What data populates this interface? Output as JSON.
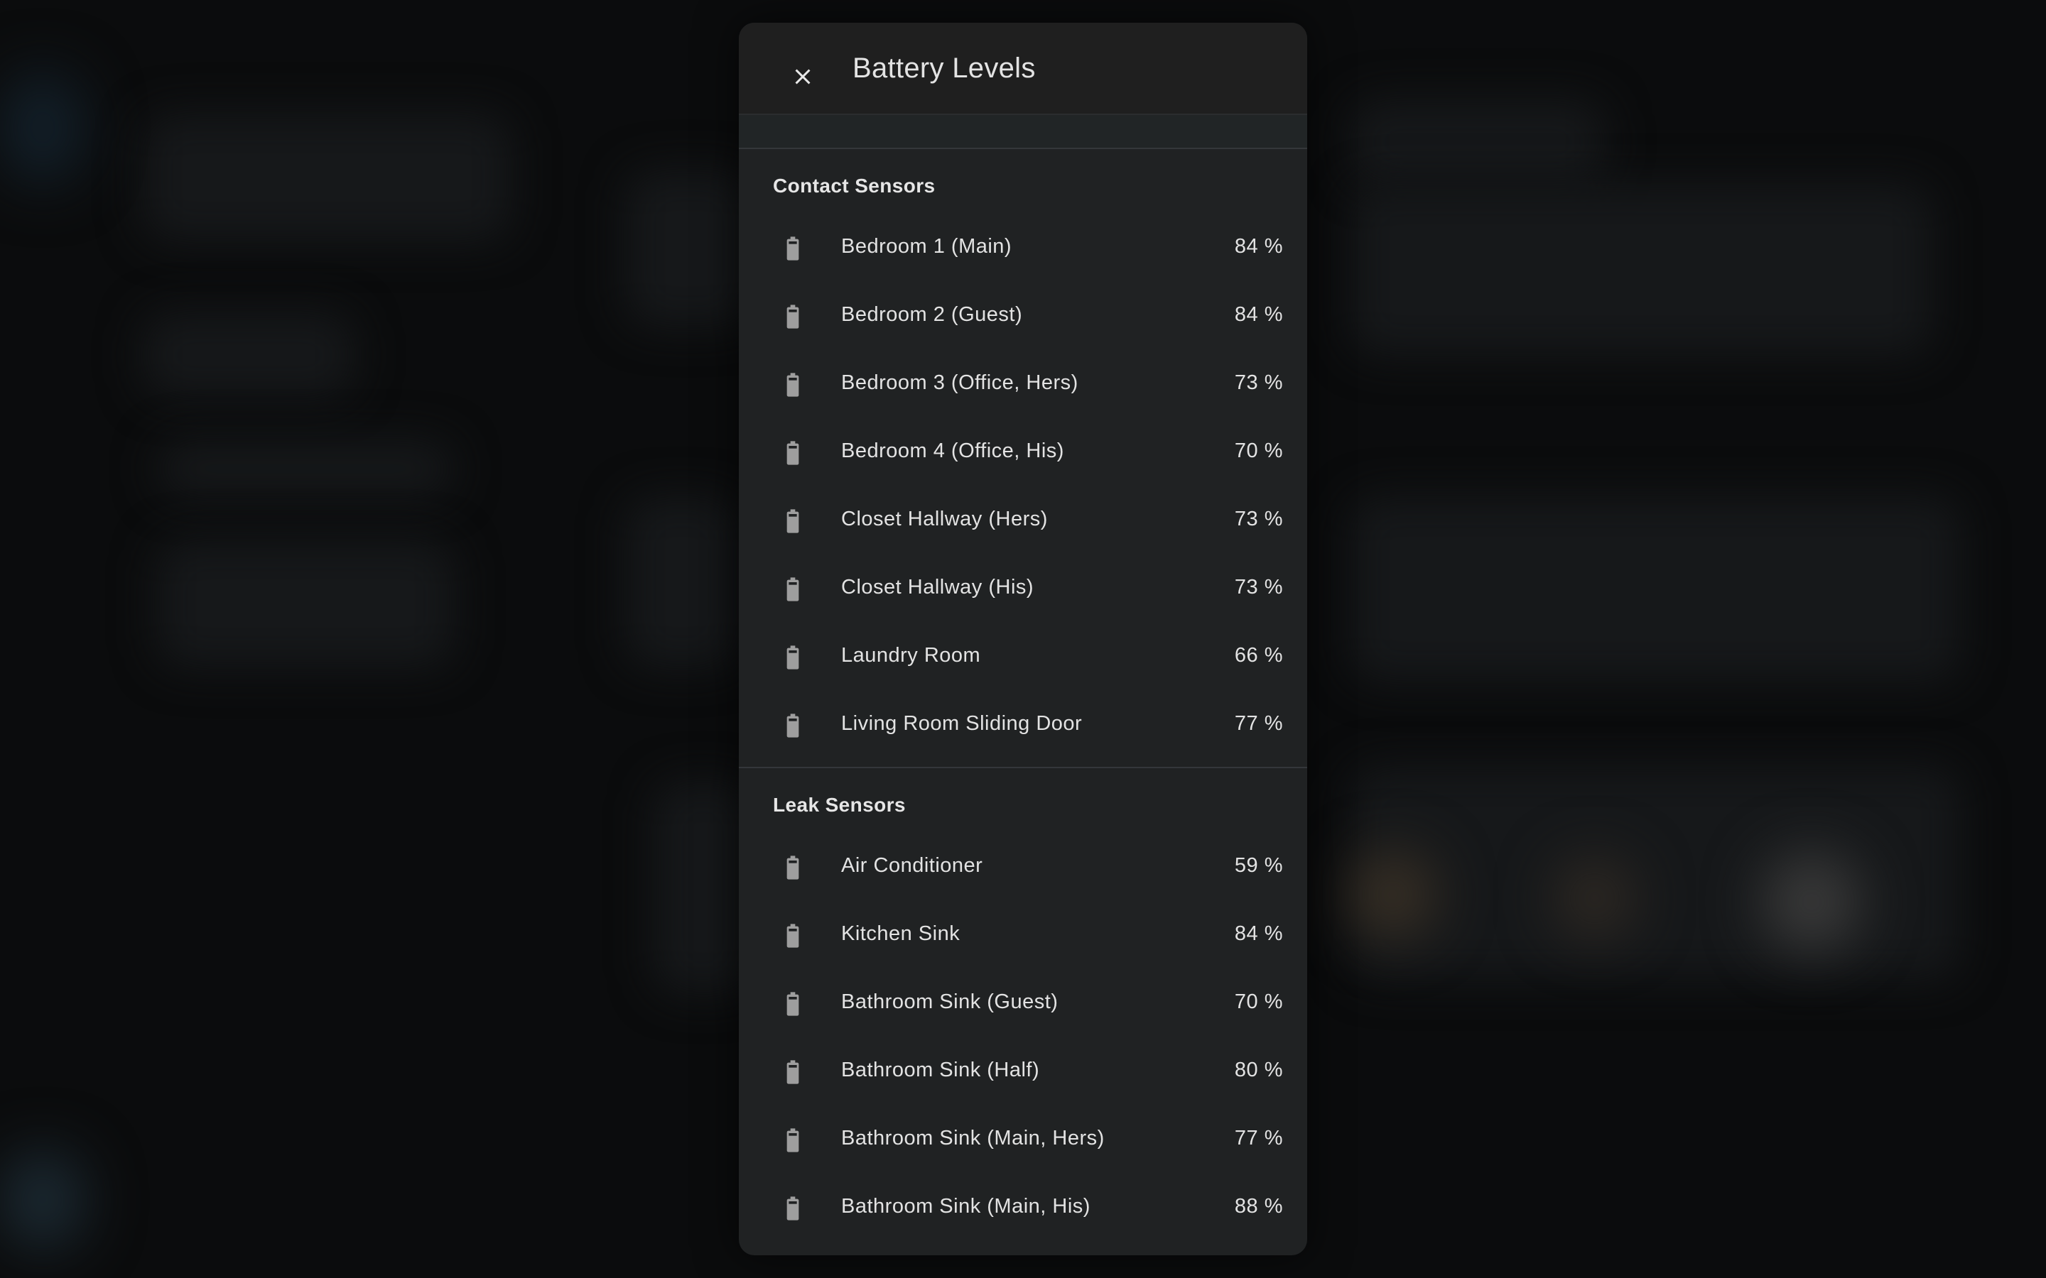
{
  "dialog": {
    "title": "Battery Levels",
    "close_icon": "close-icon"
  },
  "sections": [
    {
      "title": "Contact Sensors",
      "items": [
        {
          "name": "Bedroom 1 (Main)",
          "value": "84 %"
        },
        {
          "name": "Bedroom 2 (Guest)",
          "value": "84 %"
        },
        {
          "name": "Bedroom 3 (Office, Hers)",
          "value": "73 %"
        },
        {
          "name": "Bedroom 4 (Office, His)",
          "value": "70 %"
        },
        {
          "name": "Closet Hallway (Hers)",
          "value": "73 %"
        },
        {
          "name": "Closet Hallway (His)",
          "value": "73 %"
        },
        {
          "name": "Laundry Room",
          "value": "66 %"
        },
        {
          "name": "Living Room Sliding Door",
          "value": "77 %"
        }
      ]
    },
    {
      "title": "Leak Sensors",
      "items": [
        {
          "name": "Air Conditioner",
          "value": "59 %"
        },
        {
          "name": "Kitchen Sink",
          "value": "84 %"
        },
        {
          "name": "Bathroom Sink (Guest)",
          "value": "70 %"
        },
        {
          "name": "Bathroom Sink (Half)",
          "value": "80 %"
        },
        {
          "name": "Bathroom Sink (Main, Hers)",
          "value": "77 %"
        },
        {
          "name": "Bathroom Sink (Main, His)",
          "value": "88 %"
        }
      ]
    }
  ],
  "icons": {
    "row": "battery-icon"
  },
  "colors": {
    "icon": "#9e9e9e",
    "text": "#e3e3e3",
    "surface": "#202223",
    "backdrop": "#0b0c0d"
  }
}
